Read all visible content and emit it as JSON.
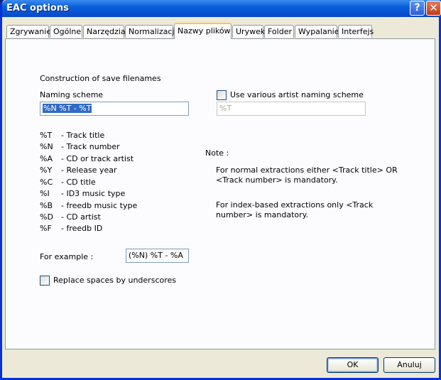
{
  "window": {
    "title": "EAC options",
    "help_glyph": "?",
    "close_glyph": "✕"
  },
  "tabs": [
    "Zgrywanie",
    "Ogólne",
    "Narzędzia",
    "Normalizacja",
    "Nazwy plików",
    "Urywek",
    "Folder",
    "Wypalanie",
    "Interfejs"
  ],
  "active_tab": "Nazwy plików",
  "content": {
    "section_title": "Construction of save filenames",
    "naming_scheme_label": "Naming scheme",
    "naming_scheme_value": "%N %T - %T",
    "various_checkbox_label": "Use various artist naming scheme",
    "various_scheme_value": "%T",
    "codes": [
      {
        "code": "%T",
        "desc": "- Track title"
      },
      {
        "code": "%N",
        "desc": "- Track number"
      },
      {
        "code": "%A",
        "desc": "- CD or track artist"
      },
      {
        "code": "%Y",
        "desc": "- Release year"
      },
      {
        "code": "%C",
        "desc": "- CD title"
      },
      {
        "code": "%I",
        "desc": "- ID3 music type"
      },
      {
        "code": "%B",
        "desc": "- freedb music type"
      },
      {
        "code": "%D",
        "desc": "- CD artist"
      },
      {
        "code": "%F",
        "desc": "- freedb ID"
      }
    ],
    "note_label": "Note :",
    "note_1": "For normal extractions either <Track title>  OR  <Track number> is mandatory.",
    "note_2": "For index-based extractions only <Track number> is mandatory.",
    "example_label": "For example :",
    "example_value": "(%N) %T - %A",
    "underscores_label": "Replace spaces by underscores"
  },
  "buttons": {
    "ok": "OK",
    "cancel": "Anuluj"
  },
  "colors": {
    "titlebar": "#0a5fd8",
    "dialog_bg": "#ece9d8",
    "panel_bg": "#fcfcfe",
    "selection": "#316ac5",
    "active_tab_accent": "#ffc83c"
  }
}
